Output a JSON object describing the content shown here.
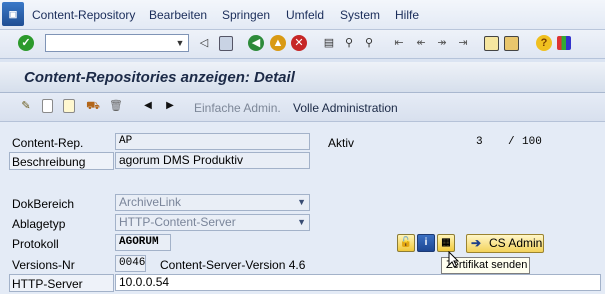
{
  "menubar": {
    "items": [
      "Content-Repository",
      "Bearbeiten",
      "Springen",
      "Umfeld",
      "System",
      "Hilfe"
    ]
  },
  "toolbar": {
    "command_field_value": "",
    "icons": [
      "enter-icon",
      "back-icon",
      "save-icon",
      "back-nav-icon",
      "exit-icon",
      "cancel-icon",
      "print-icon",
      "find-icon",
      "find-next-icon",
      "first-page-icon",
      "prev-page-icon",
      "next-page-icon",
      "last-page-icon",
      "create-session-icon",
      "shortcut-icon",
      "help-icon",
      "layout-menu-icon"
    ]
  },
  "title": "Content-Repositories anzeigen: Detail",
  "app_toolbar": {
    "icons": [
      "edit-icon",
      "create-icon",
      "copy-icon",
      "transport-icon",
      "delete-icon",
      "prev-object-icon",
      "next-object-icon"
    ],
    "simple_admin_label": "Einfache Admin.",
    "full_admin_label": "Volle Administration"
  },
  "form": {
    "content_rep_label": "Content-Rep.",
    "content_rep_value": "AP",
    "status_value": "Aktiv",
    "count_current": "3",
    "count_sep": "/",
    "count_max": "100",
    "description_label": "Beschreibung",
    "description_value": "agorum DMS Produktiv",
    "doc_area_label": "DokBereich",
    "doc_area_value": "ArchiveLink",
    "storage_type_label": "Ablagetyp",
    "storage_type_value": "HTTP-Content-Server",
    "protocol_label": "Protokoll",
    "protocol_value": "AGORUM",
    "version_label": "Versions-Nr",
    "version_value": "0046",
    "version_text": "Content-Server-Version 4.6",
    "http_server_label": "HTTP-Server",
    "http_server_value": "10.0.0.54"
  },
  "cs_admin_label": "CS Admin",
  "tooltip": "Zertifikat senden"
}
